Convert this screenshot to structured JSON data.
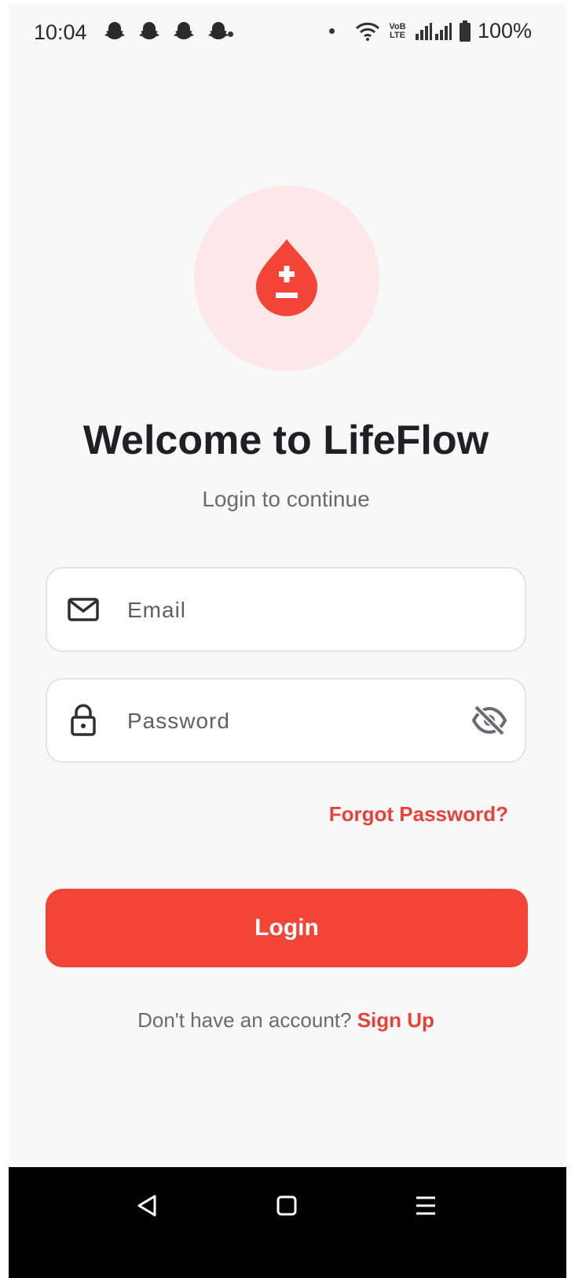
{
  "status_bar": {
    "time": "10:04",
    "lte_label": "VoB LTE",
    "battery": "100%"
  },
  "icons": {
    "notification": "snapchat-ghost-icon",
    "wifi": "wifi-icon",
    "signal": "signal-bars-icon",
    "battery": "battery-icon",
    "logo": "blood-drop-plus-minus-icon",
    "email": "mail-icon",
    "password": "lock-icon",
    "visibility": "eye-off-icon",
    "nav_back": "back-triangle-icon",
    "nav_home": "home-square-icon",
    "nav_menu": "menu-lines-icon"
  },
  "colors": {
    "accent": "#f24538",
    "logo_bg": "#fde8e9",
    "background": "#f8f8f8"
  },
  "header": {
    "title": "Welcome to LifeFlow",
    "subtitle": "Login to continue"
  },
  "form": {
    "email_placeholder": "Email",
    "email_value": "",
    "password_placeholder": "Password",
    "password_value": "",
    "forgot_label": "Forgot Password?",
    "login_label": "Login"
  },
  "footer": {
    "prompt": "Don't have an account?",
    "signup_label": "Sign Up"
  }
}
